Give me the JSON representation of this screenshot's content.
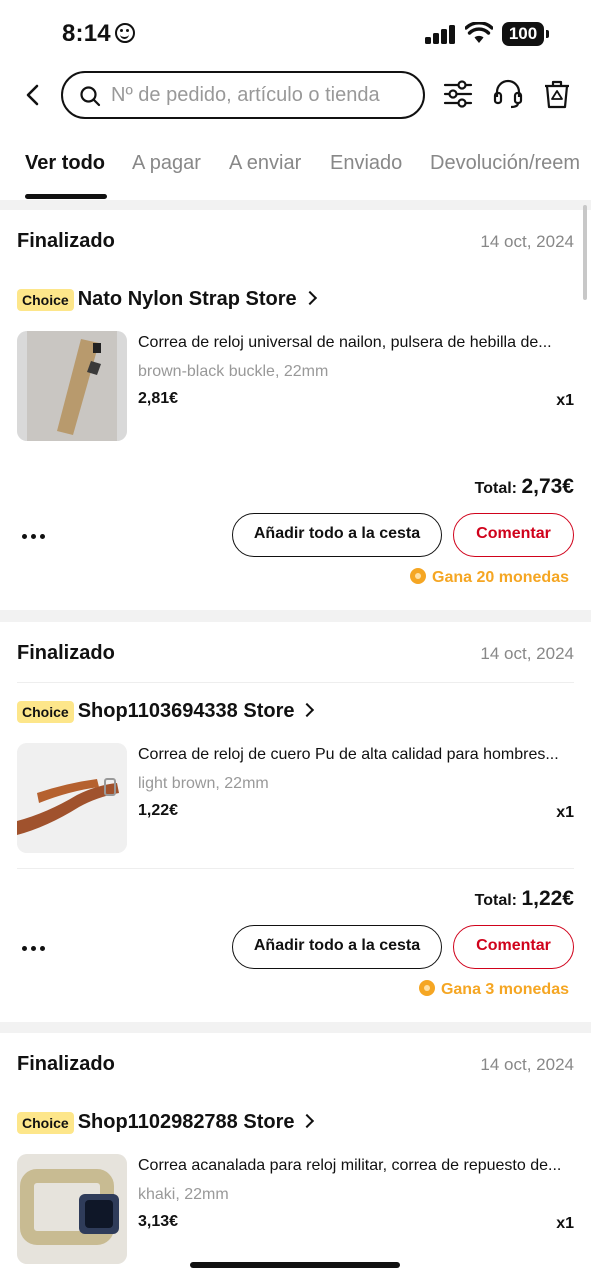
{
  "status_bar": {
    "time": "8:14",
    "battery": "100"
  },
  "header": {
    "search_placeholder": "Nº de pedido, artículo o tienda",
    "tabs": [
      {
        "label": "Ver todo",
        "active": true
      },
      {
        "label": "A pagar",
        "active": false
      },
      {
        "label": "A enviar",
        "active": false
      },
      {
        "label": "Enviado",
        "active": false
      },
      {
        "label": "Devolución/reem",
        "active": false
      }
    ]
  },
  "orders": [
    {
      "status": "Finalizado",
      "date": "14 oct, 2024",
      "badge": "Choice",
      "store": "Nato Nylon Strap Store",
      "item_title": "Correa de reloj universal de nailon, pulsera de hebilla de...",
      "variant": "brown-black buckle, 22mm",
      "price": "2,81€",
      "qty": "x1",
      "total_label": "Total:",
      "total_amount": "2,73€",
      "cart_button": "Añadir todo a la cesta",
      "comment_button": "Comentar",
      "coins": "Gana 20 monedas"
    },
    {
      "status": "Finalizado",
      "date": "14 oct, 2024",
      "badge": "Choice",
      "store": "Shop1103694338 Store",
      "item_title": "Correa de reloj de cuero Pu de alta calidad para hombres...",
      "variant": "light brown, 22mm",
      "price": "1,22€",
      "qty": "x1",
      "total_label": "Total:",
      "total_amount": "1,22€",
      "cart_button": "Añadir todo a la cesta",
      "comment_button": "Comentar",
      "coins": "Gana 3 monedas"
    },
    {
      "status": "Finalizado",
      "date": "14 oct, 2024",
      "badge": "Choice",
      "store": "Shop1102982788 Store",
      "item_title": "Correa acanalada para reloj militar, correa de repuesto de...",
      "variant": "khaki, 22mm",
      "price": "3,13€",
      "qty": "x1"
    }
  ],
  "colors": {
    "accent_red": "#d0021b",
    "coin_orange": "#f5a623",
    "choice_yellow": "#fde68a"
  },
  "icons": [
    "back-icon",
    "search-icon",
    "filter-icon",
    "support-headset-icon",
    "delete-icon",
    "chevron-right-icon",
    "more-icon",
    "coin-icon"
  ]
}
